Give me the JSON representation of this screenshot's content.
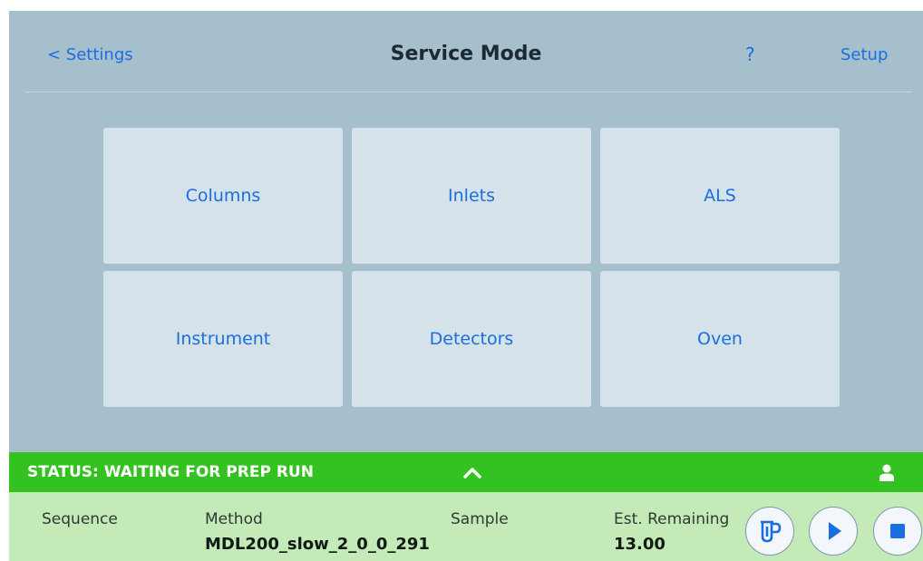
{
  "header": {
    "back_label": "< Settings",
    "title": "Service Mode",
    "help_label": "?",
    "setup_label": "Setup"
  },
  "tiles": [
    {
      "label": "Columns"
    },
    {
      "label": "Inlets"
    },
    {
      "label": "ALS"
    },
    {
      "label": "Instrument"
    },
    {
      "label": "Detectors"
    },
    {
      "label": "Oven"
    }
  ],
  "status": {
    "text": "STATUS: WAITING FOR PREP RUN",
    "color": "#34c221"
  },
  "info": {
    "sequence_label": "Sequence",
    "method_label": "Method",
    "method_value": "MDL200_slow_2_0_0_291",
    "sample_label": "Sample",
    "remaining_label": "Est. Remaining",
    "remaining_value": "13.00"
  },
  "icons": {
    "prep": "prep-run-icon",
    "play": "play-icon",
    "stop": "stop-icon",
    "chevron": "chevron-up-icon",
    "user": "user-icon"
  },
  "colors": {
    "background": "#a5bfcc",
    "tile": "#d5e2e9",
    "link": "#1a6fe0",
    "info_bar": "#c4eab8",
    "control_icon": "#1a6fe0"
  }
}
